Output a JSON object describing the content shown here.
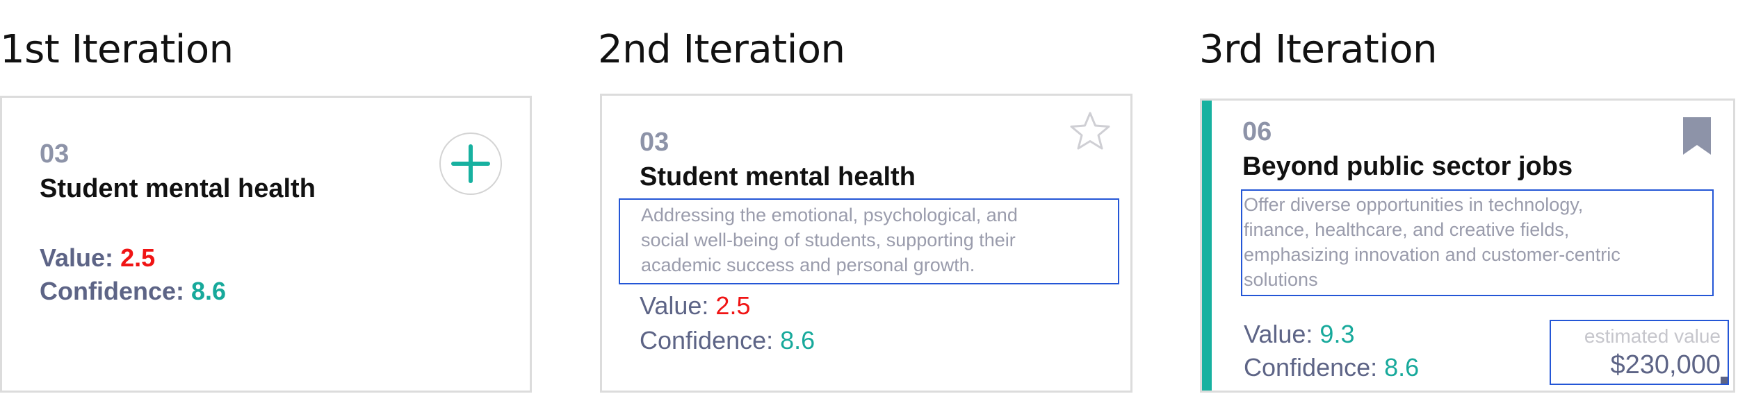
{
  "iterations": [
    {
      "heading": "1st Iteration",
      "card": {
        "number": "03",
        "title": "Student mental health",
        "value_label": "Value:",
        "value": "2.5",
        "confidence_label": "Confidence:",
        "confidence": "8.6",
        "action_icon": "plus-icon"
      }
    },
    {
      "heading": "2nd Iteration",
      "card": {
        "number": "03",
        "title": "Student mental health",
        "description_lines": [
          "Addressing the emotional, psychological, and",
          "social well-being of students, supporting their",
          "academic success and personal growth."
        ],
        "value_label": "Value:",
        "value": "2.5",
        "confidence_label": "Confidence:",
        "confidence": "8.6",
        "action_icon": "star-icon"
      }
    },
    {
      "heading": "3rd Iteration",
      "card": {
        "number": "06",
        "title": "Beyond public sector jobs",
        "description_lines": [
          "Offer diverse opportunities in technology,",
          "finance, healthcare, and creative fields,",
          "emphasizing innovation and customer-centric",
          "solutions"
        ],
        "value_label": "Value:",
        "value": "9.3",
        "confidence_label": "Confidence:",
        "confidence": "8.6",
        "estimate_label": "estimated value",
        "estimate_value": "$230,000",
        "action_icon": "bookmark-icon"
      }
    }
  ],
  "colors": {
    "accent_teal": "#17b1a0",
    "value_low_red": "#f01414",
    "value_good_teal": "#17a99b",
    "label_slate": "#5d6486",
    "number_gray": "#8d93a8",
    "highlight_blue": "#2456d6"
  }
}
